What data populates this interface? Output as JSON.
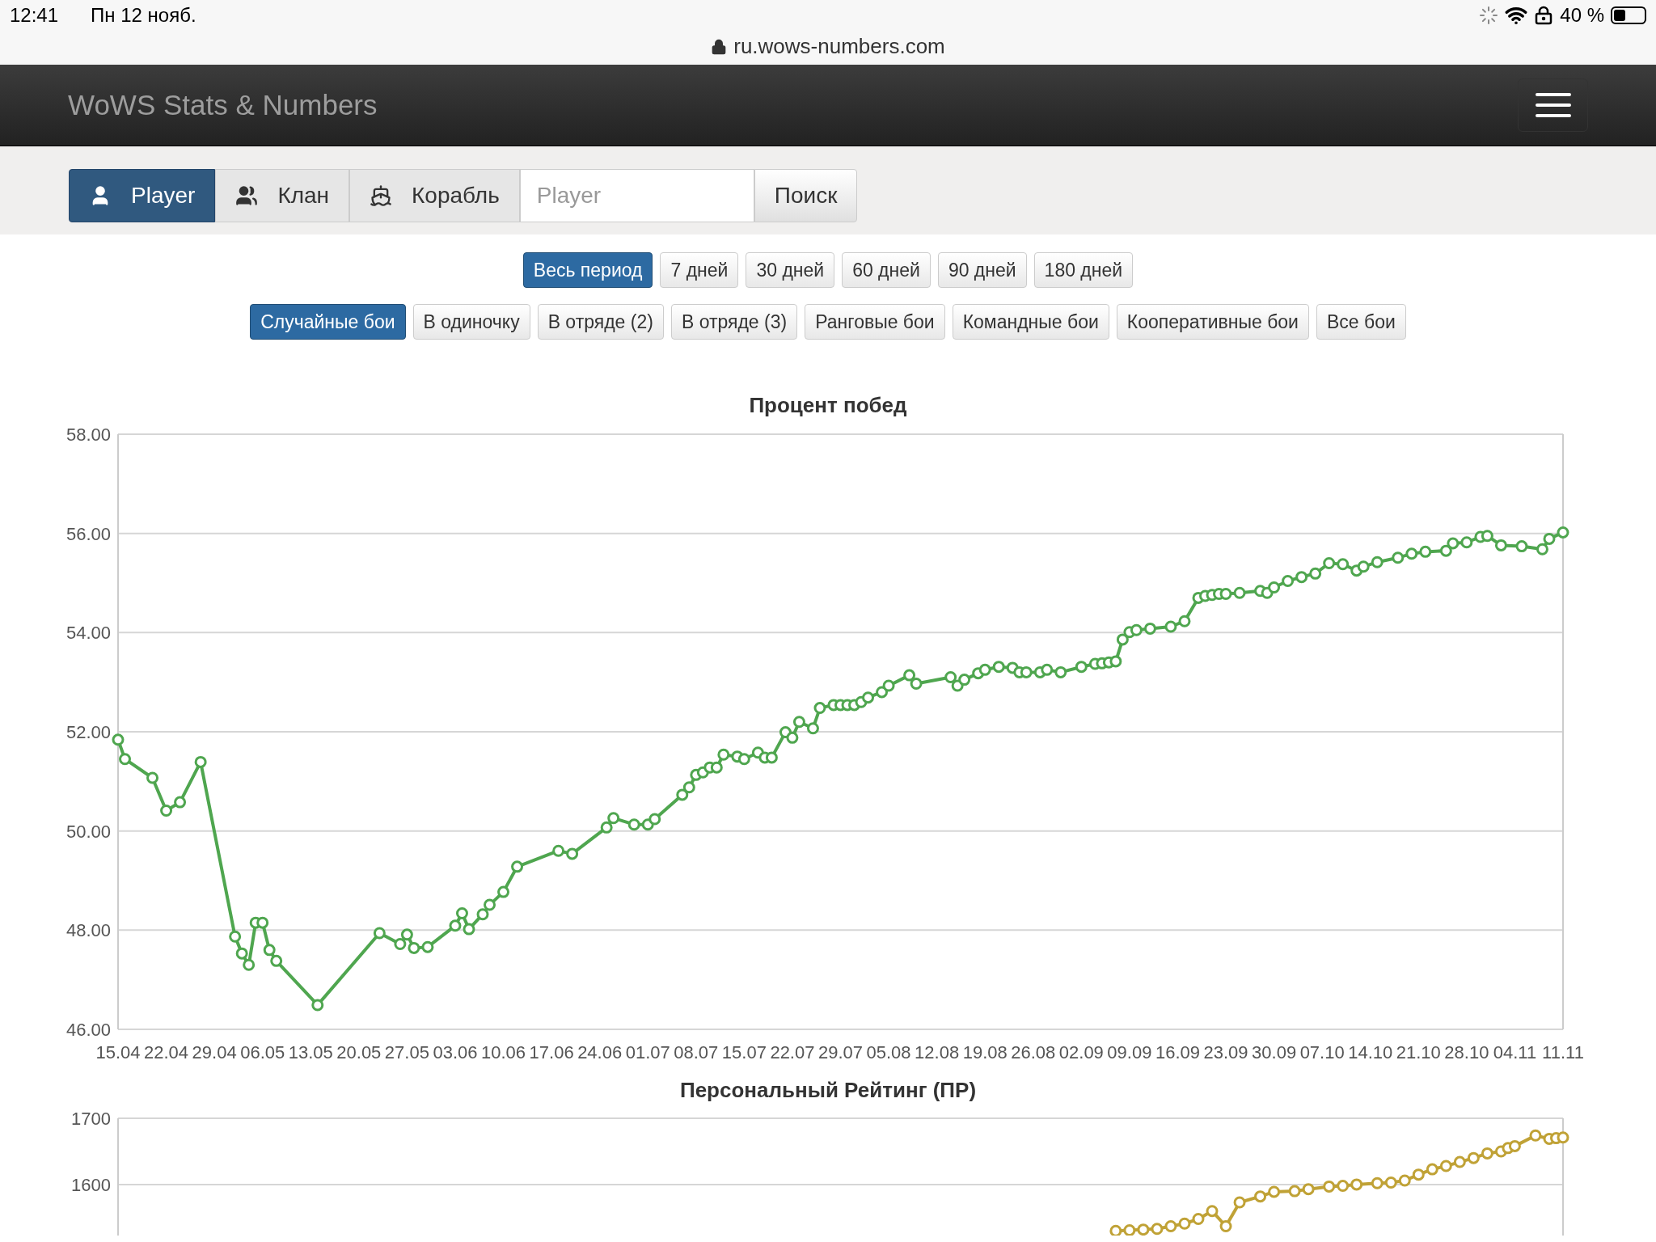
{
  "status_bar": {
    "time": "12:41",
    "date": "Пн 12 нояб.",
    "battery": "40 %"
  },
  "address_bar": {
    "url": "ru.wows-numbers.com"
  },
  "navbar": {
    "brand": "WoWS Stats & Numbers"
  },
  "search": {
    "tabs": [
      {
        "label": "Player",
        "kind": "player",
        "selected": true
      },
      {
        "label": "Клан",
        "kind": "clan",
        "selected": false
      },
      {
        "label": "Корабль",
        "kind": "ship",
        "selected": false
      }
    ],
    "placeholder": "Player",
    "button": "Поиск"
  },
  "period_filters": [
    {
      "label": "Весь период",
      "selected": true
    },
    {
      "label": "7 дней",
      "selected": false
    },
    {
      "label": "30 дней",
      "selected": false
    },
    {
      "label": "60 дней",
      "selected": false
    },
    {
      "label": "90 дней",
      "selected": false
    },
    {
      "label": "180 дней",
      "selected": false
    }
  ],
  "mode_filters": [
    {
      "label": "Случайные бои",
      "selected": true
    },
    {
      "label": "В одиночку",
      "selected": false
    },
    {
      "label": "В отряде (2)",
      "selected": false
    },
    {
      "label": "В отряде (3)",
      "selected": false
    },
    {
      "label": "Ранговые бои",
      "selected": false
    },
    {
      "label": "Командные бои",
      "selected": false
    },
    {
      "label": "Кооперативные бои",
      "selected": false
    },
    {
      "label": "Все бои",
      "selected": false
    }
  ],
  "charts": [
    {
      "chart_data": {
        "type": "line",
        "title": "Процент побед",
        "grid": true,
        "ylim": [
          46,
          58
        ],
        "yticks": [
          {
            "value": 46,
            "label": "46.00"
          },
          {
            "value": 48,
            "label": "48.00"
          },
          {
            "value": 50,
            "label": "50.00"
          },
          {
            "value": 52,
            "label": "52.00"
          },
          {
            "value": 54,
            "label": "54.00"
          },
          {
            "value": 56,
            "label": "56.00"
          },
          {
            "value": 58,
            "label": "58.00"
          }
        ],
        "categories": [
          "15.04",
          null,
          null,
          null,
          null,
          null,
          null,
          "22.04",
          null,
          null,
          null,
          null,
          null,
          null,
          "29.04",
          null,
          null,
          null,
          null,
          null,
          null,
          "06.05",
          null,
          null,
          null,
          null,
          null,
          null,
          "13.05",
          null,
          null,
          null,
          null,
          null,
          null,
          "20.05",
          null,
          null,
          null,
          null,
          null,
          null,
          "27.05",
          null,
          null,
          null,
          null,
          null,
          null,
          "03.06",
          null,
          null,
          null,
          null,
          null,
          null,
          "10.06",
          null,
          null,
          null,
          null,
          null,
          null,
          "17.06",
          null,
          null,
          null,
          null,
          null,
          null,
          "24.06",
          null,
          null,
          null,
          null,
          null,
          null,
          "01.07",
          null,
          null,
          null,
          null,
          null,
          null,
          "08.07",
          null,
          null,
          null,
          null,
          null,
          null,
          "15.07",
          null,
          null,
          null,
          null,
          null,
          null,
          "22.07",
          null,
          null,
          null,
          null,
          null,
          null,
          "29.07",
          null,
          null,
          null,
          null,
          null,
          null,
          "05.08",
          null,
          null,
          null,
          null,
          null,
          null,
          "12.08",
          null,
          null,
          null,
          null,
          null,
          null,
          "19.08",
          null,
          null,
          null,
          null,
          null,
          null,
          "26.08",
          null,
          null,
          null,
          null,
          null,
          null,
          "02.09",
          null,
          null,
          null,
          null,
          null,
          null,
          "09.09",
          null,
          null,
          null,
          null,
          null,
          null,
          "16.09",
          null,
          null,
          null,
          null,
          null,
          null,
          "23.09",
          null,
          null,
          null,
          null,
          null,
          null,
          "30.09",
          null,
          null,
          null,
          null,
          null,
          null,
          "07.10",
          null,
          null,
          null,
          null,
          null,
          null,
          "14.10",
          null,
          null,
          null,
          null,
          null,
          null,
          "21.10",
          null,
          null,
          null,
          null,
          null,
          null,
          "28.10",
          null,
          null,
          null,
          null,
          null,
          null,
          "04.11",
          null,
          null,
          null,
          null,
          null,
          null,
          "11.11"
        ],
        "series": [
          {
            "color": "#4fa64f",
            "marker": true,
            "values": [
              51.84,
              51.45,
              null,
              null,
              null,
              51.07,
              null,
              50.41,
              null,
              50.58,
              null,
              null,
              51.39,
              null,
              null,
              null,
              null,
              47.87,
              47.53,
              47.3,
              48.15,
              48.15,
              47.6,
              47.38,
              null,
              null,
              null,
              null,
              null,
              46.49,
              null,
              null,
              null,
              null,
              null,
              null,
              null,
              null,
              47.94,
              null,
              null,
              47.72,
              47.91,
              47.64,
              null,
              47.66,
              null,
              null,
              null,
              48.09,
              48.34,
              48.02,
              null,
              48.32,
              48.51,
              null,
              48.77,
              null,
              49.28,
              null,
              null,
              null,
              null,
              null,
              49.6,
              null,
              49.54,
              null,
              null,
              null,
              null,
              50.07,
              50.26,
              null,
              null,
              50.13,
              null,
              50.13,
              50.24,
              null,
              null,
              null,
              50.73,
              50.88,
              51.13,
              51.18,
              51.28,
              51.28,
              51.54,
              null,
              51.5,
              51.45,
              null,
              51.58,
              51.48,
              51.48,
              null,
              51.99,
              51.88,
              52.2,
              null,
              52.07,
              52.48,
              null,
              52.54,
              52.54,
              52.54,
              52.54,
              52.6,
              52.69,
              null,
              52.8,
              52.93,
              null,
              null,
              53.14,
              52.97,
              null,
              null,
              null,
              null,
              53.1,
              52.93,
              53.05,
              null,
              53.18,
              53.25,
              null,
              53.31,
              null,
              53.29,
              53.2,
              53.2,
              null,
              53.2,
              53.25,
              null,
              53.2,
              null,
              null,
              53.31,
              null,
              53.37,
              53.38,
              53.4,
              53.42,
              53.86,
              54.01,
              54.05,
              null,
              54.08,
              null,
              null,
              54.12,
              null,
              54.23,
              null,
              54.7,
              54.74,
              54.76,
              54.78,
              54.78,
              null,
              54.8,
              null,
              null,
              54.84,
              54.8,
              54.91,
              null,
              55.04,
              null,
              55.12,
              null,
              55.19,
              null,
              55.4,
              null,
              55.38,
              null,
              55.25,
              55.33,
              null,
              55.42,
              null,
              null,
              55.51,
              null,
              55.59,
              null,
              55.63,
              null,
              null,
              55.65,
              55.8,
              null,
              55.82,
              null,
              55.93,
              55.95,
              null,
              55.76,
              null,
              null,
              55.74,
              null,
              null,
              55.68,
              55.89,
              null,
              56.02
            ]
          }
        ]
      }
    },
    {
      "chart_data": {
        "type": "line",
        "title": "Персональный Рейтинг (ПР)",
        "grid": true,
        "ylim": [
          1523,
          1700
        ],
        "yticks": [
          {
            "value": 1600,
            "label": "1600"
          },
          {
            "value": 1700,
            "label": "1700"
          }
        ],
        "categories": [
          null,
          null,
          null,
          null,
          null,
          null,
          null,
          null,
          null,
          null,
          null,
          null,
          null,
          null,
          null,
          null,
          null,
          null,
          null,
          null,
          null,
          null,
          null,
          null,
          null,
          null,
          null,
          null,
          null,
          null,
          null,
          null,
          null,
          null,
          null,
          null,
          null,
          null,
          null,
          null,
          null,
          null,
          null,
          null,
          null,
          null,
          null,
          null,
          null,
          null,
          null,
          null,
          null,
          null,
          null,
          null,
          null,
          null,
          null,
          null,
          null,
          null,
          null,
          null,
          null,
          null,
          null,
          null,
          null,
          null,
          null,
          null,
          null,
          null,
          null,
          null,
          null,
          null,
          null,
          null,
          null,
          null,
          null,
          null,
          null,
          null,
          null,
          null,
          null,
          null,
          null,
          null,
          null,
          null,
          null,
          null,
          null,
          null,
          null,
          null,
          null,
          null,
          null,
          null,
          null,
          null,
          null,
          null,
          null,
          null,
          null,
          null,
          null,
          null,
          null,
          null,
          null,
          null,
          null,
          null,
          null,
          null,
          null,
          null,
          null,
          null,
          null,
          null,
          null,
          null,
          null,
          null,
          null,
          null,
          null,
          null,
          null,
          null,
          null,
          null,
          null,
          null,
          null,
          null,
          null,
          null,
          null,
          null,
          null,
          null,
          null,
          null,
          null,
          null,
          null,
          null,
          null,
          null,
          null,
          null,
          null,
          null,
          null,
          null,
          null,
          null,
          null,
          null,
          null,
          null,
          null,
          null,
          null,
          null,
          null,
          null,
          null,
          null,
          null,
          null,
          null,
          null,
          null,
          null,
          null,
          null,
          null,
          null,
          null,
          null,
          null,
          null,
          null,
          null,
          null,
          null,
          null,
          null,
          null,
          null,
          null,
          null,
          null,
          null,
          null,
          null,
          null,
          null,
          null,
          null,
          null
        ],
        "series": [
          {
            "color": "#c0a236",
            "marker": true,
            "values": [
              null,
              null,
              null,
              null,
              null,
              null,
              null,
              null,
              null,
              null,
              null,
              null,
              null,
              null,
              null,
              null,
              null,
              null,
              null,
              null,
              null,
              null,
              null,
              null,
              null,
              null,
              null,
              null,
              null,
              null,
              null,
              null,
              null,
              null,
              null,
              null,
              null,
              null,
              null,
              null,
              null,
              null,
              null,
              null,
              null,
              null,
              null,
              null,
              null,
              null,
              null,
              null,
              null,
              null,
              null,
              null,
              null,
              null,
              null,
              null,
              null,
              null,
              null,
              null,
              null,
              null,
              null,
              null,
              null,
              null,
              null,
              null,
              null,
              null,
              null,
              null,
              null,
              null,
              null,
              null,
              null,
              null,
              null,
              null,
              null,
              null,
              null,
              null,
              null,
              null,
              null,
              null,
              null,
              null,
              null,
              null,
              null,
              null,
              null,
              null,
              null,
              null,
              null,
              null,
              null,
              null,
              null,
              null,
              null,
              null,
              null,
              null,
              null,
              null,
              null,
              null,
              null,
              null,
              null,
              null,
              null,
              null,
              null,
              null,
              null,
              null,
              null,
              null,
              null,
              null,
              null,
              null,
              null,
              null,
              null,
              null,
              null,
              null,
              null,
              null,
              null,
              null,
              null,
              null,
              null,
              1530,
              null,
              1531,
              null,
              1532,
              null,
              1533,
              null,
              1537,
              null,
              1541,
              null,
              1548,
              null,
              1560,
              null,
              1537,
              null,
              1573,
              null,
              null,
              1582,
              null,
              1589,
              null,
              null,
              1590,
              null,
              1593,
              null,
              null,
              1597,
              null,
              1598,
              null,
              1600,
              null,
              null,
              1602,
              null,
              1603,
              null,
              1606,
              null,
              1615,
              null,
              1623,
              null,
              1628,
              null,
              1634,
              null,
              1640,
              null,
              1647,
              null,
              1650,
              1655,
              1658,
              null,
              null,
              1674,
              null,
              1669,
              1670,
              1671
            ]
          }
        ]
      }
    }
  ]
}
